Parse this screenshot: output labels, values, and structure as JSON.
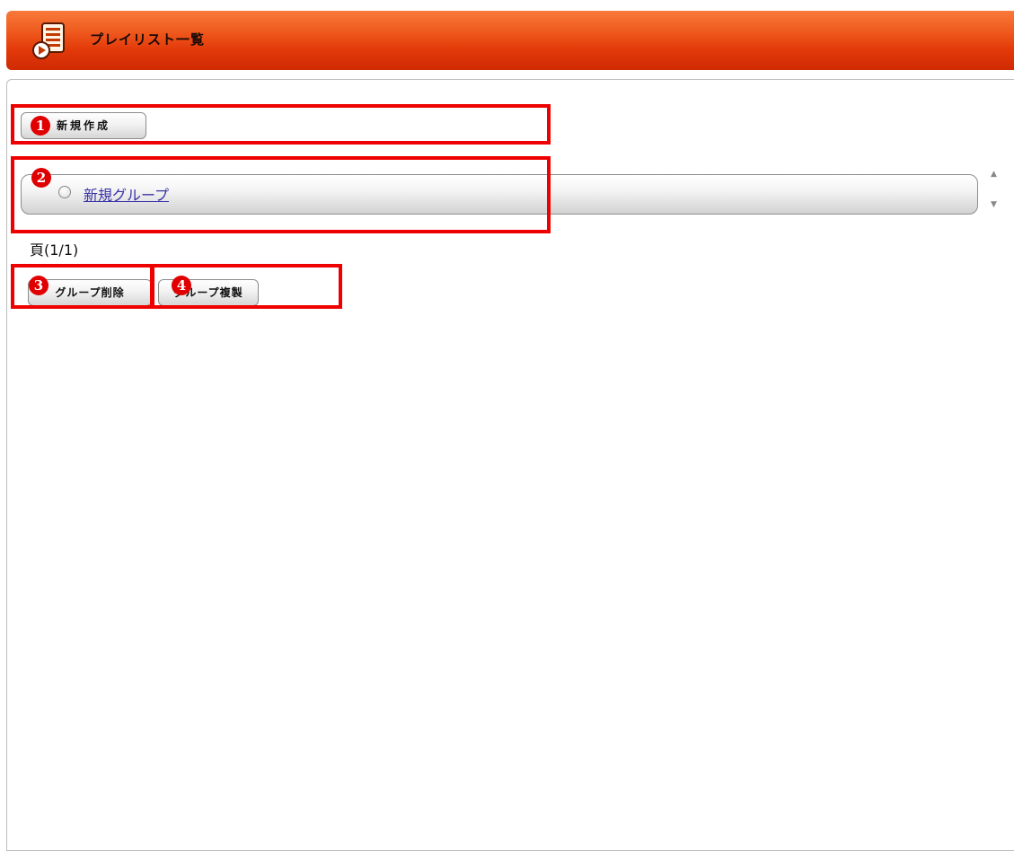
{
  "header": {
    "title": "プレイリスト一覧",
    "icon": "playlist-icon"
  },
  "toolbar": {
    "new_label": "新規作成"
  },
  "groups": [
    {
      "label": "新規グループ",
      "selected": false
    }
  ],
  "paging": {
    "text": "頁(1/1)"
  },
  "actions": {
    "delete_label": "グループ削除",
    "duplicate_label": "グループ複製"
  },
  "annotations": [
    {
      "number": "1"
    },
    {
      "number": "2"
    },
    {
      "number": "3"
    },
    {
      "number": "4"
    }
  ],
  "colors": {
    "header_gradient_top": "#f87a3a",
    "header_gradient_bottom": "#cf2a04",
    "annotation_red": "#ee0000",
    "link": "#3a35a8"
  }
}
